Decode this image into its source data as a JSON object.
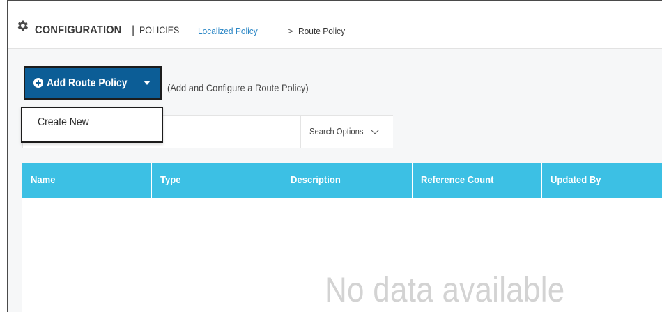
{
  "header": {
    "title_main": "CONFIGURATION",
    "title_separator": "|",
    "title_sub": "POLICIES",
    "breadcrumb": {
      "link": "Localized Policy",
      "separator": ">",
      "current": "Route Policy"
    },
    "icon": "gear-icon"
  },
  "toolbar": {
    "add_button_label": "Add Route Policy",
    "add_button_icon": "plus-circle-icon",
    "add_hint": "(Add and Configure a Route Policy)",
    "accent_color": "#0c5d96"
  },
  "dropdown": {
    "items": [
      {
        "label": "Create New"
      }
    ]
  },
  "search": {
    "placeholder": "",
    "value": "",
    "options_label": "Search Options"
  },
  "table": {
    "header_color": "#3cc0e4",
    "columns": [
      "Name",
      "Type",
      "Description",
      "Reference Count",
      "Updated By"
    ],
    "rows": [],
    "empty_message": "No data available"
  }
}
